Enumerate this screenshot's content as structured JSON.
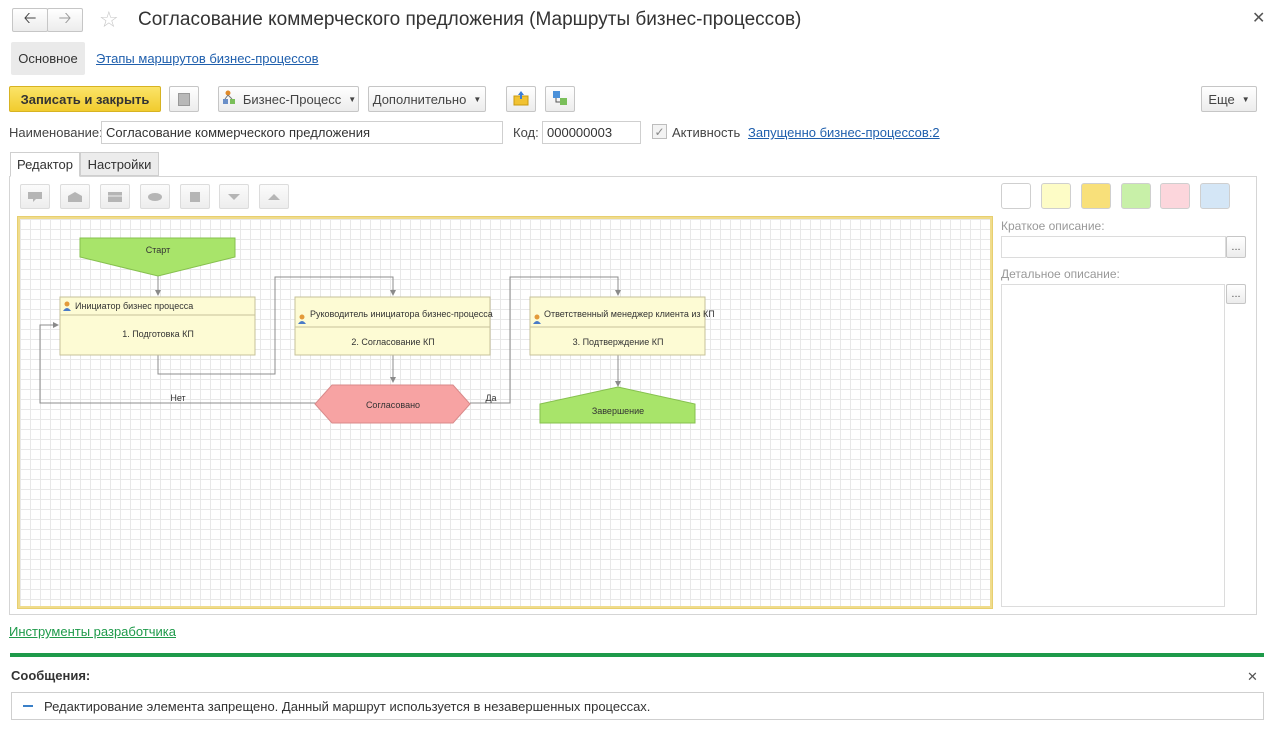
{
  "header": {
    "title": "Согласование коммерческого предложения (Маршруты бизнес-процессов)",
    "back_icon": "arrow-left-icon",
    "forward_icon": "arrow-right-icon",
    "favorite_icon": "star-icon",
    "close_icon": "close-icon"
  },
  "nav_tabs": {
    "main": "Основное",
    "stages": "Этапы маршрутов бизнес-процессов"
  },
  "toolbar": {
    "save_close": "Записать и закрыть",
    "business_process": "Бизнес-Процесс",
    "additional": "Дополнительно",
    "more": "Еще"
  },
  "fields": {
    "name_label": "Наименование:",
    "name_value": "Согласование коммерческого предложения",
    "code_label": "Код:",
    "code_value": "000000003",
    "activity_label": "Активность",
    "activity_checked": true,
    "launched_link": "Запущенно бизнес-процессов:2"
  },
  "tabs": {
    "editor": "Редактор",
    "settings": "Настройки"
  },
  "colors": {
    "accent_yellow": "#f7d94a",
    "start_end_green": "#a8e46a",
    "decision_red": "#f7a3a3",
    "task_box": "#fdfbd4",
    "message_bar": "#1e9a4a",
    "swatches": [
      "#ffffff",
      "#fdfcc6",
      "#f8e07a",
      "#c8f0a8",
      "#fcd6dc",
      "#d4e6f6"
    ]
  },
  "diagram": {
    "start": "Старт",
    "tasks": [
      {
        "role": "Инициатор бизнес процесса",
        "step": "1. Подготовка КП"
      },
      {
        "role": "Руководитель инициатора бизнес-процесса",
        "step": "2. Согласование КП"
      },
      {
        "role": "Ответственный менеджер клиента из КП",
        "step": "3. Подтверждение КП"
      }
    ],
    "decision": "Согласовано",
    "no_label": "Нет",
    "yes_label": "Да",
    "end": "Завершение"
  },
  "side_panel": {
    "short_label": "Краткое описание:",
    "detail_label": "Детальное описание:",
    "ellipsis": "..."
  },
  "footer": {
    "dev_tools_link": "Инструменты разработчика"
  },
  "messages": {
    "title": "Сообщения:",
    "items": [
      "Редактирование элемента запрещено. Данный маршрут используется в незавершенных процессах."
    ]
  }
}
